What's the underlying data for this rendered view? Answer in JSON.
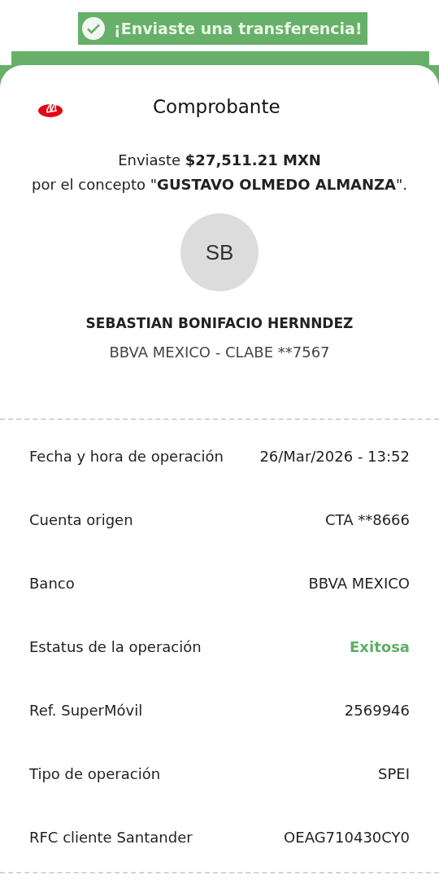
{
  "banner": {
    "text": "¡Enviaste una transferencia!"
  },
  "header": {
    "title": "Comprobante"
  },
  "summary": {
    "line_1": "Enviaste **$27,511.21 MXN**",
    "line_2": "por el concepto \"**GUSTAVO OLMEDO ALMANZA**\"."
  },
  "recipient": {
    "initials": "SB",
    "name": "SEBASTIAN BONIFACIO HERNNDEZ",
    "account": "BBVA MEXICO - CLABE **7567"
  },
  "details": [
    {
      "label": "Fecha y hora de operación",
      "value": "26/Mar/2026 - 13:52",
      "kind": "text"
    },
    {
      "label": "Cuenta origen",
      "value": "CTA **8666",
      "kind": "text"
    },
    {
      "label": "Banco",
      "value": "BBVA MEXICO",
      "kind": "text"
    },
    {
      "label": "Estatus de la operación",
      "value": "Exitosa",
      "kind": "status"
    },
    {
      "label": "Ref. SuperMóvil",
      "value": "2569946",
      "kind": "text"
    },
    {
      "label": "Tipo de operación",
      "value": "SPEI",
      "kind": "text"
    },
    {
      "label": "RFC cliente Santander",
      "value": "OEAG710430CY0",
      "kind": "text"
    }
  ]
}
